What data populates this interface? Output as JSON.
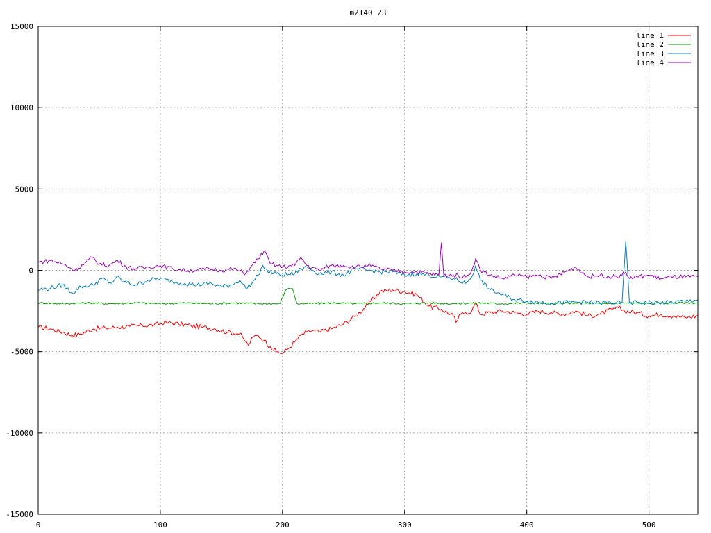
{
  "chart_data": {
    "type": "line",
    "title": "m2140_23",
    "xlabel": "",
    "ylabel": "",
    "xlim": [
      0,
      540
    ],
    "ylim": [
      -15000,
      15000
    ],
    "x_ticks": [
      0,
      100,
      200,
      300,
      400,
      500
    ],
    "y_ticks": [
      -15000,
      -10000,
      -5000,
      0,
      5000,
      10000,
      15000
    ],
    "grid": true,
    "legend_position": "top-right",
    "series": [
      {
        "name": "line 1",
        "color": "#ff0000",
        "x": [
          0,
          10,
          20,
          28,
          35,
          45,
          55,
          65,
          75,
          85,
          95,
          105,
          115,
          125,
          135,
          145,
          155,
          165,
          168,
          172,
          176,
          180,
          185,
          190,
          195,
          200,
          205,
          210,
          215,
          220,
          225,
          230,
          240,
          250,
          260,
          270,
          280,
          290,
          300,
          310,
          320,
          330,
          340,
          342,
          346,
          350,
          355,
          358,
          362,
          370,
          380,
          390,
          400,
          410,
          420,
          430,
          440,
          450,
          460,
          470,
          475,
          480,
          490,
          500,
          510,
          520,
          530,
          540
        ],
        "y": [
          -3500,
          -3600,
          -3800,
          -4000,
          -3900,
          -3600,
          -3550,
          -3500,
          -3450,
          -3400,
          -3350,
          -3200,
          -3300,
          -3400,
          -3500,
          -3600,
          -3800,
          -3900,
          -4200,
          -4600,
          -4100,
          -4000,
          -4300,
          -4700,
          -5000,
          -5100,
          -4800,
          -4400,
          -4000,
          -3800,
          -3700,
          -3800,
          -3600,
          -3300,
          -2800,
          -2100,
          -1300,
          -1200,
          -1300,
          -1500,
          -2200,
          -2400,
          -2800,
          -3200,
          -2700,
          -2600,
          -2500,
          -2000,
          -2700,
          -2600,
          -2500,
          -2600,
          -2700,
          -2500,
          -2600,
          -2700,
          -2500,
          -2800,
          -2700,
          -2400,
          -2300,
          -2500,
          -2600,
          -2800,
          -2700,
          -2800,
          -2900,
          -2800
        ]
      },
      {
        "name": "line 2",
        "color": "#00a000",
        "x": [
          0,
          20,
          40,
          60,
          80,
          100,
          120,
          140,
          160,
          180,
          198,
          202,
          205,
          208,
          210,
          212,
          220,
          240,
          260,
          280,
          300,
          320,
          340,
          360,
          380,
          400,
          420,
          440,
          460,
          480,
          500,
          520,
          540
        ],
        "y": [
          -2000,
          -2050,
          -2000,
          -2050,
          -2000,
          -2050,
          -2000,
          -2050,
          -2000,
          -2050,
          -2050,
          -1300,
          -1100,
          -1100,
          -1600,
          -2050,
          -2050,
          -2000,
          -2050,
          -2000,
          -2050,
          -2000,
          -2050,
          -2000,
          -2050,
          -2000,
          -2050,
          -2000,
          -2050,
          -2000,
          -2050,
          -2000,
          -2000
        ]
      },
      {
        "name": "line 3",
        "color": "#0080c0",
        "x": [
          0,
          10,
          20,
          28,
          35,
          45,
          52,
          60,
          64,
          70,
          80,
          90,
          100,
          110,
          120,
          130,
          140,
          150,
          158,
          165,
          170,
          175,
          180,
          184,
          188,
          195,
          200,
          210,
          215,
          220,
          230,
          240,
          250,
          260,
          270,
          280,
          290,
          300,
          310,
          320,
          330,
          340,
          350,
          355,
          358,
          362,
          370,
          380,
          390,
          400,
          420,
          440,
          460,
          478,
          481,
          484,
          490,
          510,
          530,
          540
        ],
        "y": [
          -1200,
          -1100,
          -900,
          -1400,
          -1000,
          -900,
          -500,
          -800,
          -400,
          -700,
          -900,
          -600,
          -500,
          -700,
          -800,
          -900,
          -800,
          -1000,
          -900,
          -600,
          -1100,
          -800,
          -300,
          300,
          -100,
          -200,
          -300,
          -200,
          100,
          200,
          -200,
          -100,
          -300,
          100,
          0,
          -100,
          -100,
          -300,
          -200,
          -300,
          -400,
          -500,
          -800,
          -400,
          300,
          -600,
          -1200,
          -1500,
          -1800,
          -1900,
          -2000,
          -1950,
          -2000,
          -2000,
          1800,
          -2000,
          -1950,
          -2000,
          -1900,
          -1800
        ]
      },
      {
        "name": "line 4",
        "color": "#a000c0",
        "x": [
          0,
          10,
          20,
          30,
          38,
          44,
          50,
          58,
          65,
          72,
          80,
          90,
          100,
          110,
          120,
          130,
          140,
          150,
          160,
          170,
          175,
          180,
          185,
          190,
          200,
          210,
          215,
          220,
          230,
          240,
          250,
          260,
          270,
          280,
          290,
          300,
          310,
          320,
          328,
          330,
          332,
          340,
          350,
          355,
          358,
          362,
          370,
          380,
          390,
          400,
          410,
          420,
          440,
          450,
          460,
          470,
          478,
          481,
          484,
          490,
          500,
          510,
          520,
          530,
          540
        ],
        "y": [
          500,
          600,
          400,
          0,
          400,
          800,
          400,
          300,
          600,
          200,
          100,
          200,
          300,
          100,
          0,
          0,
          100,
          0,
          100,
          -200,
          300,
          700,
          1200,
          400,
          200,
          300,
          800,
          300,
          0,
          300,
          300,
          200,
          300,
          100,
          0,
          -100,
          -100,
          -200,
          -300,
          1700,
          -300,
          -300,
          -400,
          0,
          700,
          0,
          -300,
          -500,
          -300,
          -400,
          -300,
          -500,
          200,
          -400,
          -300,
          -400,
          -300,
          -100,
          -500,
          -400,
          -300,
          -500,
          -400,
          -400,
          -400
        ]
      }
    ]
  }
}
